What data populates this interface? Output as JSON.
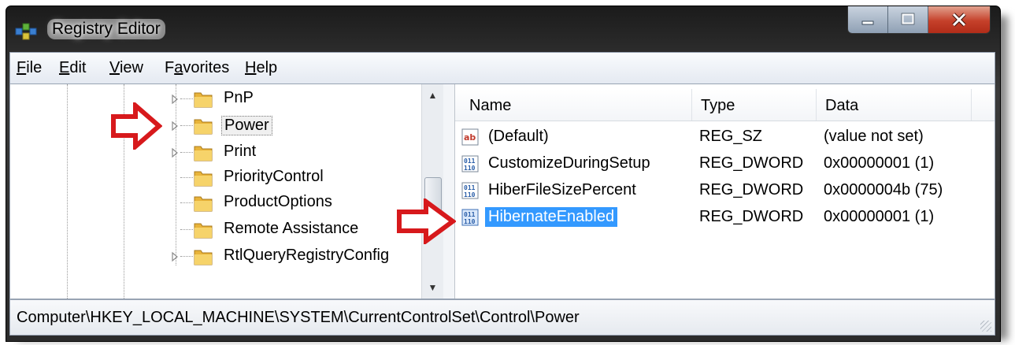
{
  "window": {
    "title": "Registry Editor",
    "controls": [
      "minimize",
      "maximize",
      "close"
    ]
  },
  "menu": [
    {
      "label": "File"
    },
    {
      "label": "Edit"
    },
    {
      "label": "View"
    },
    {
      "label": "Favorites"
    },
    {
      "label": "Help"
    }
  ],
  "tree": {
    "items": [
      {
        "label": "PnP",
        "expandable": true
      },
      {
        "label": "Power",
        "expandable": true,
        "selected": true
      },
      {
        "label": "Print",
        "expandable": true
      },
      {
        "label": "PriorityControl",
        "expandable": false
      },
      {
        "label": "ProductOptions",
        "expandable": false
      },
      {
        "label": "Remote Assistance",
        "expandable": false
      },
      {
        "label": "RtlQueryRegistryConfig",
        "expandable": true
      }
    ]
  },
  "list": {
    "columns": {
      "name": "Name",
      "type": "Type",
      "data": "Data"
    },
    "rows": [
      {
        "name": "(Default)",
        "type": "REG_SZ",
        "data": "(value not set)",
        "icon": "string-value-icon"
      },
      {
        "name": "CustomizeDuringSetup",
        "type": "REG_DWORD",
        "data": "0x00000001 (1)",
        "icon": "binary-value-icon"
      },
      {
        "name": "HiberFileSizePercent",
        "type": "REG_DWORD",
        "data": "0x0000004b (75)",
        "icon": "binary-value-icon"
      },
      {
        "name": "HibernateEnabled",
        "type": "REG_DWORD",
        "data": "0x00000001 (1)",
        "icon": "binary-value-icon",
        "selected": true
      }
    ]
  },
  "status": {
    "path": "Computer\\HKEY_LOCAL_MACHINE\\SYSTEM\\CurrentControlSet\\Control\\Power"
  },
  "colors": {
    "selection": "#3399ff",
    "annotation_arrow": "#d7191c",
    "close_button": "#c5402a"
  }
}
